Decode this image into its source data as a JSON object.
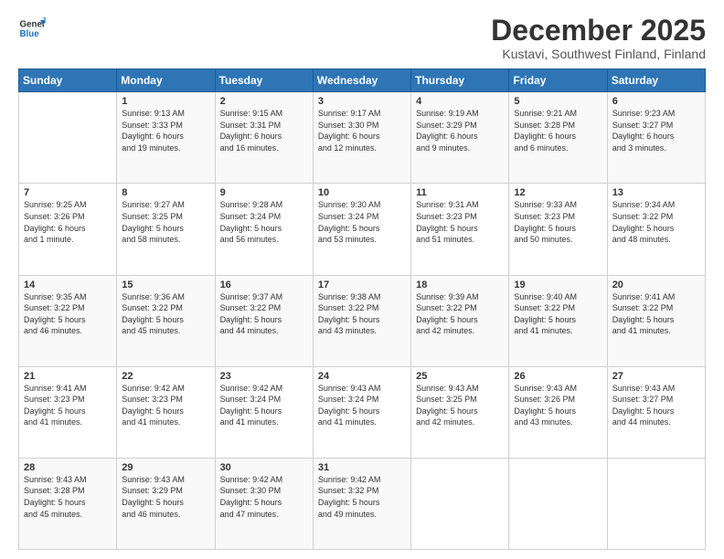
{
  "header": {
    "logo_general": "General",
    "logo_blue": "Blue",
    "title": "December 2025",
    "subtitle": "Kustavi, Southwest Finland, Finland"
  },
  "calendar": {
    "days_of_week": [
      "Sunday",
      "Monday",
      "Tuesday",
      "Wednesday",
      "Thursday",
      "Friday",
      "Saturday"
    ],
    "weeks": [
      [
        {
          "day": "",
          "info": ""
        },
        {
          "day": "1",
          "info": "Sunrise: 9:13 AM\nSunset: 3:33 PM\nDaylight: 6 hours\nand 19 minutes."
        },
        {
          "day": "2",
          "info": "Sunrise: 9:15 AM\nSunset: 3:31 PM\nDaylight: 6 hours\nand 16 minutes."
        },
        {
          "day": "3",
          "info": "Sunrise: 9:17 AM\nSunset: 3:30 PM\nDaylight: 6 hours\nand 12 minutes."
        },
        {
          "day": "4",
          "info": "Sunrise: 9:19 AM\nSunset: 3:29 PM\nDaylight: 6 hours\nand 9 minutes."
        },
        {
          "day": "5",
          "info": "Sunrise: 9:21 AM\nSunset: 3:28 PM\nDaylight: 6 hours\nand 6 minutes."
        },
        {
          "day": "6",
          "info": "Sunrise: 9:23 AM\nSunset: 3:27 PM\nDaylight: 6 hours\nand 3 minutes."
        }
      ],
      [
        {
          "day": "7",
          "info": "Sunrise: 9:25 AM\nSunset: 3:26 PM\nDaylight: 6 hours\nand 1 minute."
        },
        {
          "day": "8",
          "info": "Sunrise: 9:27 AM\nSunset: 3:25 PM\nDaylight: 5 hours\nand 58 minutes."
        },
        {
          "day": "9",
          "info": "Sunrise: 9:28 AM\nSunset: 3:24 PM\nDaylight: 5 hours\nand 56 minutes."
        },
        {
          "day": "10",
          "info": "Sunrise: 9:30 AM\nSunset: 3:24 PM\nDaylight: 5 hours\nand 53 minutes."
        },
        {
          "day": "11",
          "info": "Sunrise: 9:31 AM\nSunset: 3:23 PM\nDaylight: 5 hours\nand 51 minutes."
        },
        {
          "day": "12",
          "info": "Sunrise: 9:33 AM\nSunset: 3:23 PM\nDaylight: 5 hours\nand 50 minutes."
        },
        {
          "day": "13",
          "info": "Sunrise: 9:34 AM\nSunset: 3:22 PM\nDaylight: 5 hours\nand 48 minutes."
        }
      ],
      [
        {
          "day": "14",
          "info": "Sunrise: 9:35 AM\nSunset: 3:22 PM\nDaylight: 5 hours\nand 46 minutes."
        },
        {
          "day": "15",
          "info": "Sunrise: 9:36 AM\nSunset: 3:22 PM\nDaylight: 5 hours\nand 45 minutes."
        },
        {
          "day": "16",
          "info": "Sunrise: 9:37 AM\nSunset: 3:22 PM\nDaylight: 5 hours\nand 44 minutes."
        },
        {
          "day": "17",
          "info": "Sunrise: 9:38 AM\nSunset: 3:22 PM\nDaylight: 5 hours\nand 43 minutes."
        },
        {
          "day": "18",
          "info": "Sunrise: 9:39 AM\nSunset: 3:22 PM\nDaylight: 5 hours\nand 42 minutes."
        },
        {
          "day": "19",
          "info": "Sunrise: 9:40 AM\nSunset: 3:22 PM\nDaylight: 5 hours\nand 41 minutes."
        },
        {
          "day": "20",
          "info": "Sunrise: 9:41 AM\nSunset: 3:22 PM\nDaylight: 5 hours\nand 41 minutes."
        }
      ],
      [
        {
          "day": "21",
          "info": "Sunrise: 9:41 AM\nSunset: 3:23 PM\nDaylight: 5 hours\nand 41 minutes."
        },
        {
          "day": "22",
          "info": "Sunrise: 9:42 AM\nSunset: 3:23 PM\nDaylight: 5 hours\nand 41 minutes."
        },
        {
          "day": "23",
          "info": "Sunrise: 9:42 AM\nSunset: 3:24 PM\nDaylight: 5 hours\nand 41 minutes."
        },
        {
          "day": "24",
          "info": "Sunrise: 9:43 AM\nSunset: 3:24 PM\nDaylight: 5 hours\nand 41 minutes."
        },
        {
          "day": "25",
          "info": "Sunrise: 9:43 AM\nSunset: 3:25 PM\nDaylight: 5 hours\nand 42 minutes."
        },
        {
          "day": "26",
          "info": "Sunrise: 9:43 AM\nSunset: 3:26 PM\nDaylight: 5 hours\nand 43 minutes."
        },
        {
          "day": "27",
          "info": "Sunrise: 9:43 AM\nSunset: 3:27 PM\nDaylight: 5 hours\nand 44 minutes."
        }
      ],
      [
        {
          "day": "28",
          "info": "Sunrise: 9:43 AM\nSunset: 3:28 PM\nDaylight: 5 hours\nand 45 minutes."
        },
        {
          "day": "29",
          "info": "Sunrise: 9:43 AM\nSunset: 3:29 PM\nDaylight: 5 hours\nand 46 minutes."
        },
        {
          "day": "30",
          "info": "Sunrise: 9:42 AM\nSunset: 3:30 PM\nDaylight: 5 hours\nand 47 minutes."
        },
        {
          "day": "31",
          "info": "Sunrise: 9:42 AM\nSunset: 3:32 PM\nDaylight: 5 hours\nand 49 minutes."
        },
        {
          "day": "",
          "info": ""
        },
        {
          "day": "",
          "info": ""
        },
        {
          "day": "",
          "info": ""
        }
      ]
    ]
  }
}
